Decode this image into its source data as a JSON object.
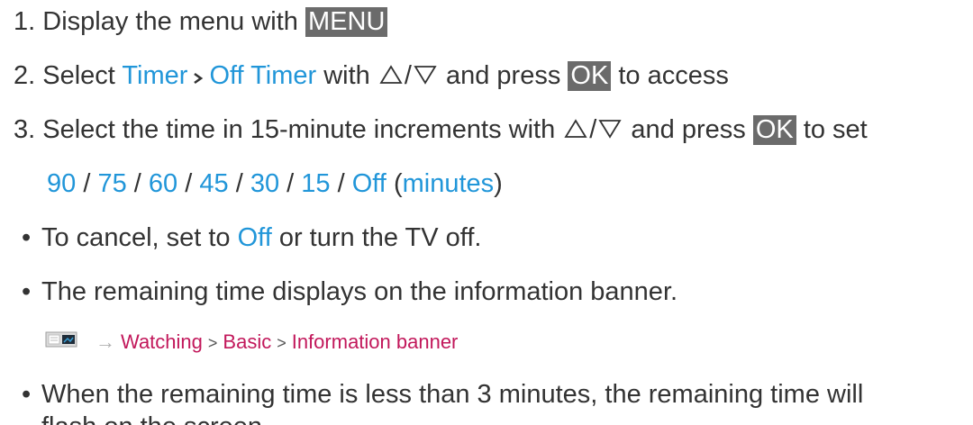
{
  "steps": [
    {
      "number": "1.",
      "text_a": "Display the menu with",
      "key": "MENU"
    },
    {
      "number": "2.",
      "text_a": "Select",
      "kw1": "Timer",
      "separator": ">",
      "kw2": "Off Timer",
      "text_b": "with",
      "slash": "/",
      "text_c": "and press",
      "key": "OK",
      "text_d": "to access"
    },
    {
      "number": "3.",
      "text_a": "Select the time in 15-minute increments with",
      "slash": "/",
      "text_c": "and press",
      "key": "OK",
      "text_d": "to set"
    }
  ],
  "options": {
    "values": [
      "90",
      "75",
      "60",
      "45",
      "30",
      "15",
      "Off"
    ],
    "slash": "/",
    "open_paren": "(",
    "unit": "minutes",
    "close_paren": ")"
  },
  "notes": [
    {
      "bullet": "•",
      "text_a": "To cancel, set to",
      "kw": "Off",
      "text_b": "or turn the TV off."
    },
    {
      "bullet": "•",
      "text_a": "The remaining time displays on the information banner."
    },
    {
      "bullet": "•",
      "text_a": "When the remaining time is less than 3 minutes, the remaining time will",
      "text_b": "flash on the screen."
    }
  ],
  "reference": {
    "icon": "emanual-reference-icon",
    "arrow": "→",
    "path": [
      "Watching",
      "Basic",
      "Information banner"
    ],
    "separator": ">"
  },
  "colors": {
    "text": "#333333",
    "keyword": "#2196d9",
    "key_bg": "#6b6b6b",
    "key_text": "#ffffff",
    "reference_link": "#c2185b"
  },
  "icons": {
    "up": "up-triangle-icon",
    "down": "down-triangle-icon",
    "chevron": "chevron-right-icon"
  }
}
